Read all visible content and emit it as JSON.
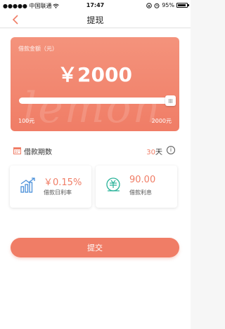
{
  "status_bar": {
    "carrier": "●●●●● 中国联通",
    "time": "17:47",
    "battery": "95%"
  },
  "nav": {
    "title": "提现"
  },
  "amount_card": {
    "label": "借款金额（元）",
    "value": "￥2000",
    "watermark": "lemon",
    "slider_min": "100元",
    "slider_max": "2000元",
    "slider_fraction": 1.0
  },
  "term": {
    "label": "借款期数",
    "value_number": "30",
    "value_unit": "天"
  },
  "stats": [
    {
      "value": "￥0.15%",
      "label": "借款日利率",
      "icon": "bar-chart-icon"
    },
    {
      "value": "90.00",
      "label": "借款利息",
      "icon": "coin-clock-icon"
    }
  ],
  "submit": {
    "label": "提交"
  },
  "colors": {
    "accent": "#f07d66",
    "card_top": "#f4937c",
    "icon_blue": "#4a90d9",
    "icon_green": "#2bb39a"
  }
}
